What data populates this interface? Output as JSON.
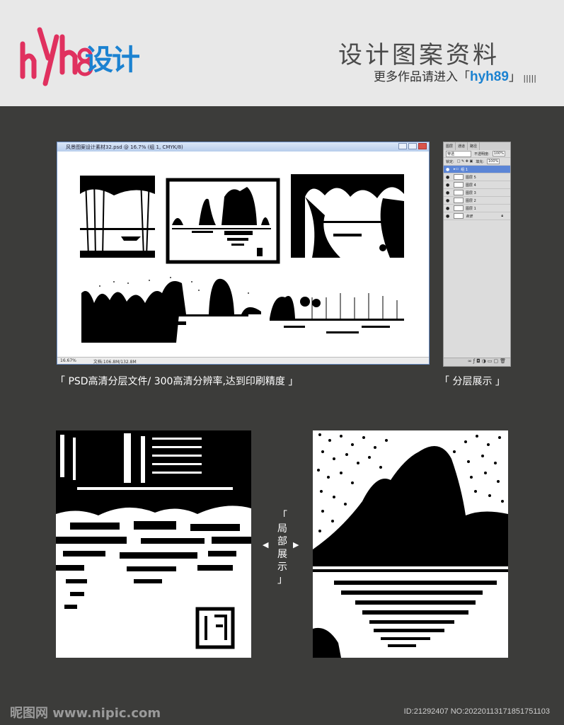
{
  "brand": {
    "logo_text": "设计",
    "title": "设计图案资料",
    "subtitle_prefix": "更多作品请进入「",
    "subtitle_link": "hyh89",
    "subtitle_suffix": "」"
  },
  "ps_window": {
    "title": "风景图案设计素材32.psd @ 16.7% (组 1, CMYK/8)",
    "zoom": "16.67%",
    "doc_info": "文档:106.8M/132.8M"
  },
  "layers_panel": {
    "tabs": [
      "图层",
      "通道",
      "路径"
    ],
    "blend_mode": "穿透",
    "opacity_label": "不透明度:",
    "opacity": "100%",
    "lock_label": "锁定:",
    "fill_label": "填充:",
    "fill": "100%",
    "layers": [
      {
        "name": "组 1",
        "selected": true
      },
      {
        "name": "图层 5",
        "selected": false
      },
      {
        "name": "图层 4",
        "selected": false
      },
      {
        "name": "图层 3",
        "selected": false
      },
      {
        "name": "图层 2",
        "selected": false
      },
      {
        "name": "图层 1",
        "selected": false
      },
      {
        "name": "背景",
        "selected": false
      }
    ]
  },
  "captions": {
    "left": "「 PSD高清分层文件/ 300高清分辨率,达到印刷精度 」",
    "right": "「 分层展示 」"
  },
  "detail_label": [
    "「",
    "局",
    "部",
    "展",
    "示",
    "」"
  ],
  "footer": {
    "left": "昵图网 www.nipic.com",
    "right": "ID:21292407 NO:20220113171851751103"
  }
}
